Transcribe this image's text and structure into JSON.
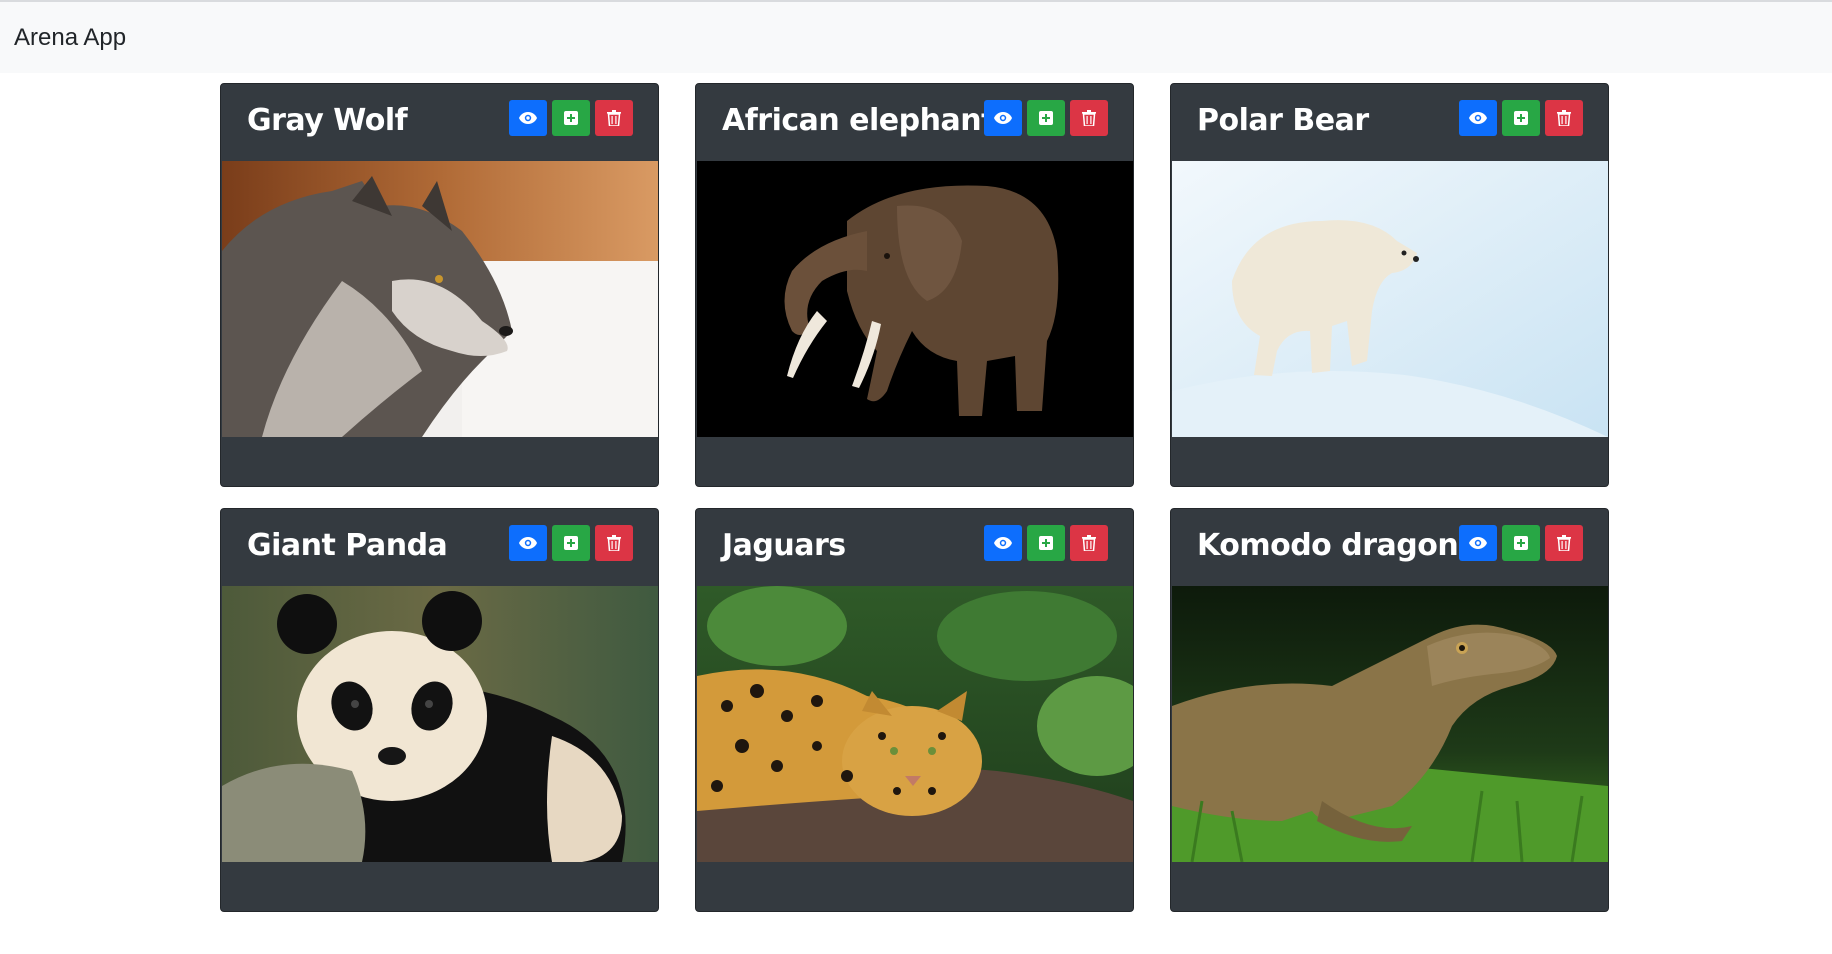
{
  "navbar": {
    "brand": "Arena App"
  },
  "cards": [
    {
      "title": "Gray Wolf"
    },
    {
      "title": "African elephant"
    },
    {
      "title": "Polar Bear"
    },
    {
      "title": "Giant Panda"
    },
    {
      "title": "Jaguars"
    },
    {
      "title": "Komodo dragons"
    }
  ],
  "buttons": {
    "view_icon": "eye-icon",
    "add_icon": "plus-square-icon",
    "delete_icon": "trash-icon"
  },
  "colors": {
    "view": "#0d6efd",
    "add": "#28a745",
    "delete": "#dc3545",
    "card_bg": "#343a40",
    "navbar_bg": "#f8f9fa"
  }
}
